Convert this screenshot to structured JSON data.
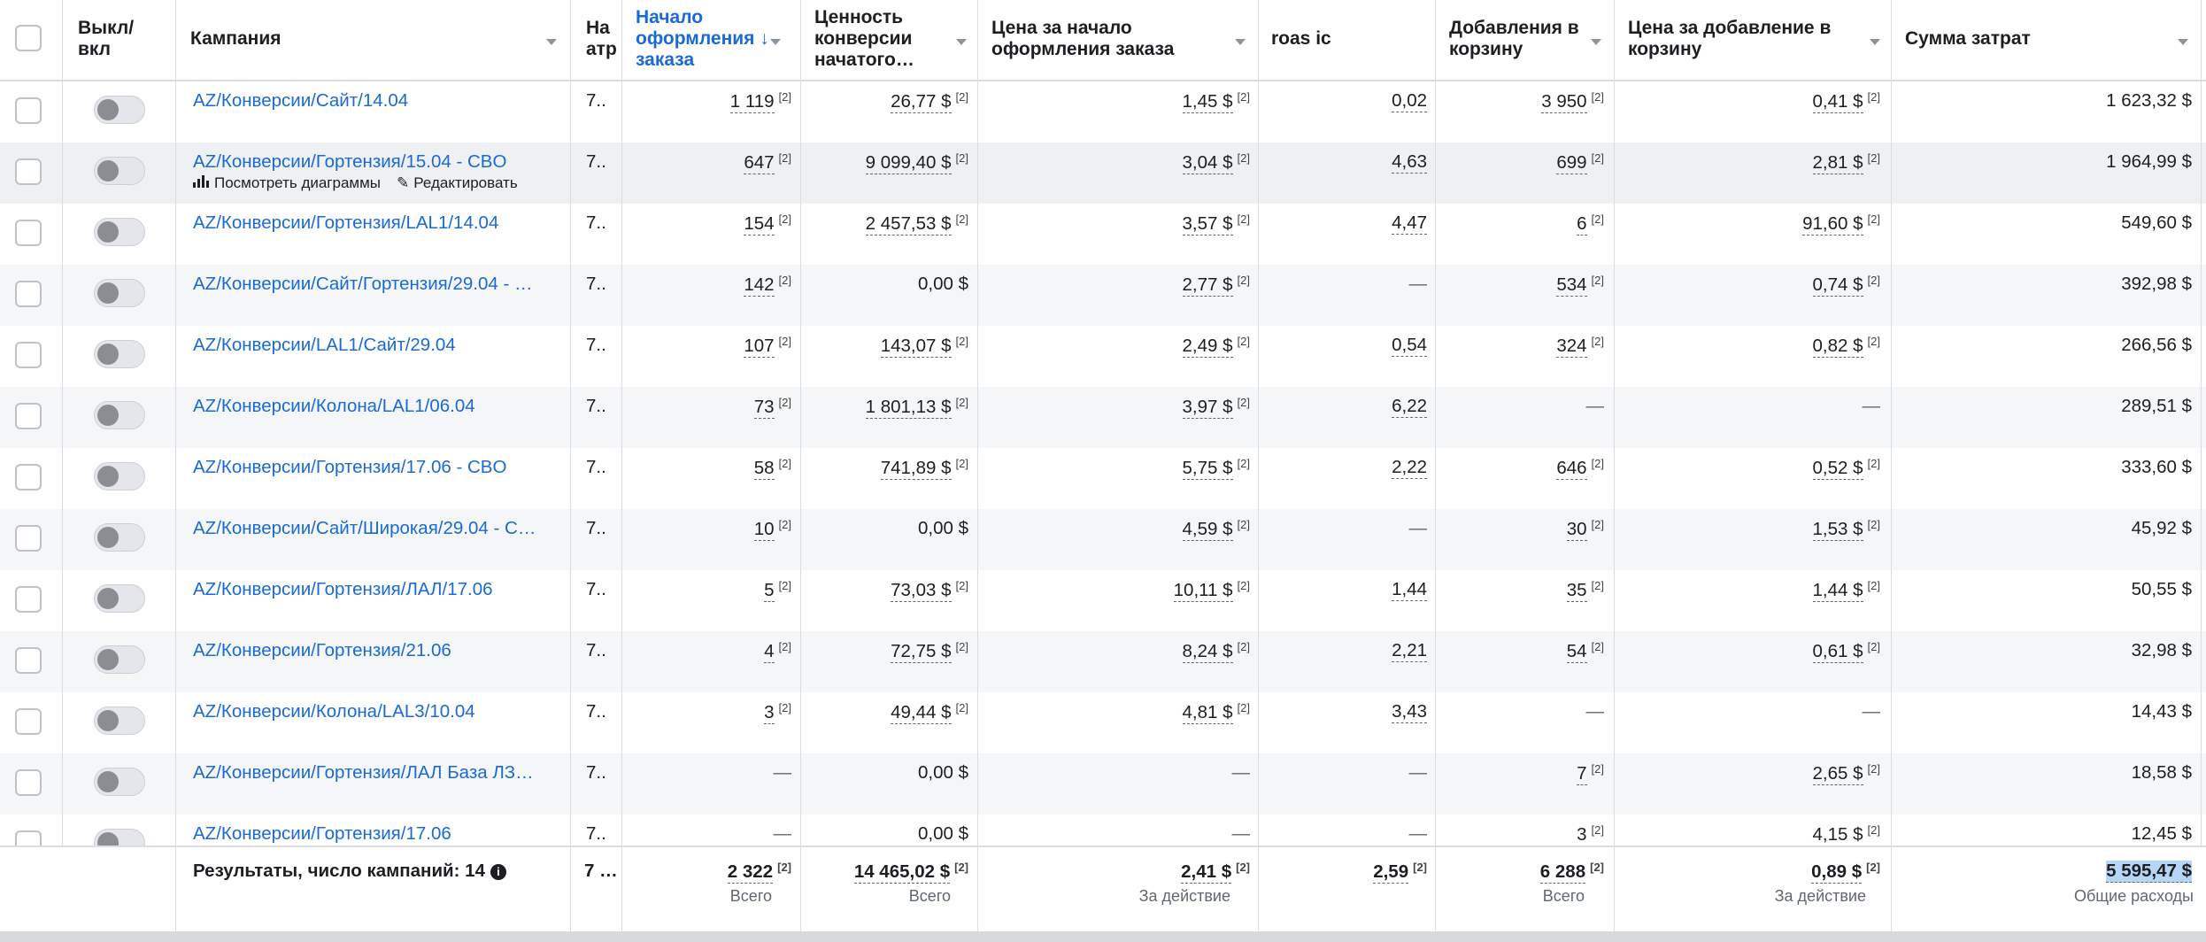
{
  "headers": {
    "toggle": "Выкл/\nвкл",
    "campaign": "Кампания",
    "attribution": "На\nатр",
    "checkouts": "Начало\nоформления ↓\nзаказа",
    "conv_value": "Ценность\nконверсии\nначатого…",
    "cost_per_checkout": "Цена за начало\nоформления заказа",
    "roas": "roas ic",
    "adds_to_cart": "Добавления в\nкорзину",
    "cost_per_add": "Цена за добавление в\nкорзину",
    "spend": "Сумма затрат"
  },
  "row_actions": {
    "charts": "Посмотреть диаграммы",
    "edit": "Редактировать"
  },
  "rows": [
    {
      "campaign": "AZ/Конверсии/Сайт/14.04",
      "attr": "7..",
      "checkouts": "1 119",
      "conv_value": "26,77 $",
      "cpc": "1,45 $",
      "roas": "0,02",
      "adds": "3 950",
      "cpa": "0,41 $",
      "spend": "1 623,32 $"
    },
    {
      "campaign": "AZ/Конверсии/Гортензия/15.04 - CBO",
      "attr": "7..",
      "checkouts": "647",
      "conv_value": "9 099,40 $",
      "cpc": "3,04 $",
      "roas": "4,63",
      "adds": "699",
      "cpa": "2,81 $",
      "spend": "1 964,99 $"
    },
    {
      "campaign": "AZ/Конверсии/Гортензия/LAL1/14.04",
      "attr": "7..",
      "checkouts": "154",
      "conv_value": "2 457,53 $",
      "cpc": "3,57 $",
      "roas": "4,47",
      "adds": "6",
      "cpa": "91,60 $",
      "spend": "549,60 $"
    },
    {
      "campaign": "AZ/Конверсии/Сайт/Гортензия/29.04 - …",
      "attr": "7..",
      "checkouts": "142",
      "conv_value": "0,00 $",
      "cpc": "2,77 $",
      "roas": "—",
      "adds": "534",
      "cpa": "0,74 $",
      "spend": "392,98 $"
    },
    {
      "campaign": "AZ/Конверсии/LAL1/Сайт/29.04",
      "attr": "7..",
      "checkouts": "107",
      "conv_value": "143,07 $",
      "cpc": "2,49 $",
      "roas": "0,54",
      "adds": "324",
      "cpa": "0,82 $",
      "spend": "266,56 $"
    },
    {
      "campaign": "AZ/Конверсии/Колона/LAL1/06.04",
      "attr": "7..",
      "checkouts": "73",
      "conv_value": "1 801,13 $",
      "cpc": "3,97 $",
      "roas": "6,22",
      "adds": "—",
      "cpa": "—",
      "spend": "289,51 $"
    },
    {
      "campaign": "AZ/Конверсии/Гортензия/17.06 - CBO",
      "attr": "7..",
      "checkouts": "58",
      "conv_value": "741,89 $",
      "cpc": "5,75 $",
      "roas": "2,22",
      "adds": "646",
      "cpa": "0,52 $",
      "spend": "333,60 $"
    },
    {
      "campaign": "AZ/Конверсии/Сайт/Широкая/29.04 - C…",
      "attr": "7..",
      "checkouts": "10",
      "conv_value": "0,00 $",
      "cpc": "4,59 $",
      "roas": "—",
      "adds": "30",
      "cpa": "1,53 $",
      "spend": "45,92 $"
    },
    {
      "campaign": "AZ/Конверсии/Гортензия/ЛАЛ/17.06",
      "attr": "7..",
      "checkouts": "5",
      "conv_value": "73,03 $",
      "cpc": "10,11 $",
      "roas": "1,44",
      "adds": "35",
      "cpa": "1,44 $",
      "spend": "50,55 $"
    },
    {
      "campaign": "AZ/Конверсии/Гортензия/21.06",
      "attr": "7..",
      "checkouts": "4",
      "conv_value": "72,75 $",
      "cpc": "8,24 $",
      "roas": "2,21",
      "adds": "54",
      "cpa": "0,61 $",
      "spend": "32,98 $"
    },
    {
      "campaign": "AZ/Конверсии/Колона/LAL3/10.04",
      "attr": "7..",
      "checkouts": "3",
      "conv_value": "49,44 $",
      "cpc": "4,81 $",
      "roas": "3,43",
      "adds": "—",
      "cpa": "—",
      "spend": "14,43 $"
    },
    {
      "campaign": "AZ/Конверсии/Гортензия/ЛАЛ База ЛЗ…",
      "attr": "7..",
      "checkouts": "—",
      "conv_value": "0,00 $",
      "cpc": "—",
      "roas": "—",
      "adds": "7",
      "cpa": "2,65 $",
      "spend": "18,58 $"
    },
    {
      "campaign": "AZ/Конверсии/Гортензия/17.06",
      "attr": "7..",
      "checkouts": "—",
      "conv_value": "0,00 $",
      "cpc": "—",
      "roas": "—",
      "adds": "3",
      "cpa": "4,15 $",
      "spend": "12,45 $"
    }
  ],
  "sup": "[2]",
  "totals": {
    "label": "Результаты, число кампаний: 14",
    "attr": "7 …",
    "checkouts": "2 322",
    "checkouts_sub": "Всего",
    "conv_value": "14 465,02 $",
    "conv_value_sub": "Всего",
    "cpc": "2,41 $",
    "cpc_sub": "За действие",
    "roas": "2,59",
    "adds": "6 288",
    "adds_sub": "Всего",
    "cpa": "0,89 $",
    "cpa_sub": "За действие",
    "spend": "5 595,47 $",
    "spend_sub": "Общие расходы"
  }
}
